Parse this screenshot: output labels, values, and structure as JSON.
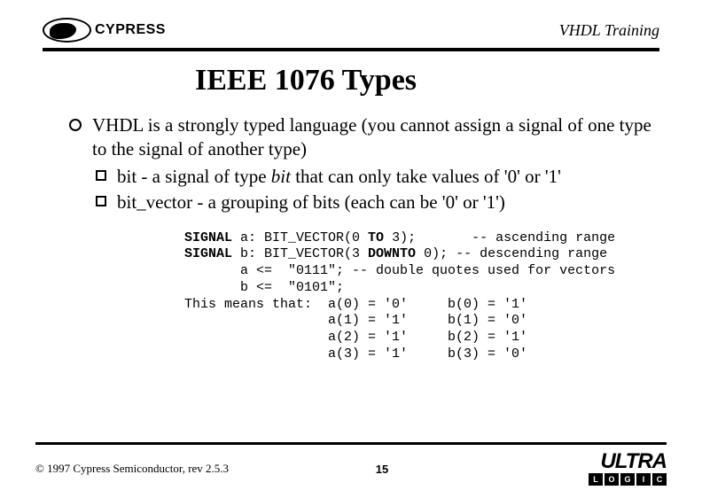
{
  "header": {
    "brand": "CYPRESS",
    "right": "VHDL Training"
  },
  "title": "IEEE 1076 Types",
  "bullets": {
    "main": "VHDL is a strongly typed language (you cannot assign a signal of one type to the signal of another type)",
    "sub1_prefix": "bit - a signal of type ",
    "sub1_italic": "bit",
    "sub1_suffix": " that can only take values of '0' or '1'",
    "sub2": "bit_vector - a grouping of bits (each can be  '0'  or '1')"
  },
  "code": {
    "l1a": "SIGNAL",
    "l1b": " a: BIT_VECTOR(0 ",
    "l1c": "TO",
    "l1d": " 3);       -- ascending range",
    "l2a": "SIGNAL",
    "l2b": " b: BIT_VECTOR(3 ",
    "l2c": "DOWNTO",
    "l2d": " 0); -- descending range",
    "l3": "       a <=  \"0111\"; -- double quotes used for vectors",
    "l4": "       b <=  \"0101\";",
    "l5": "This means that:  a(0) = '0'     b(0) = '1'",
    "l6": "                  a(1) = '1'     b(1) = '0'",
    "l7": "                  a(2) = '1'     b(2) = '1'",
    "l8": "                  a(3) = '1'     b(3) = '0'"
  },
  "footer": {
    "copyright": "© 1997 Cypress Semiconductor, rev 2.5.3",
    "page": "15",
    "ultra": "ULTRA",
    "boxes": [
      "L",
      "O",
      "G",
      "I",
      "C"
    ]
  }
}
